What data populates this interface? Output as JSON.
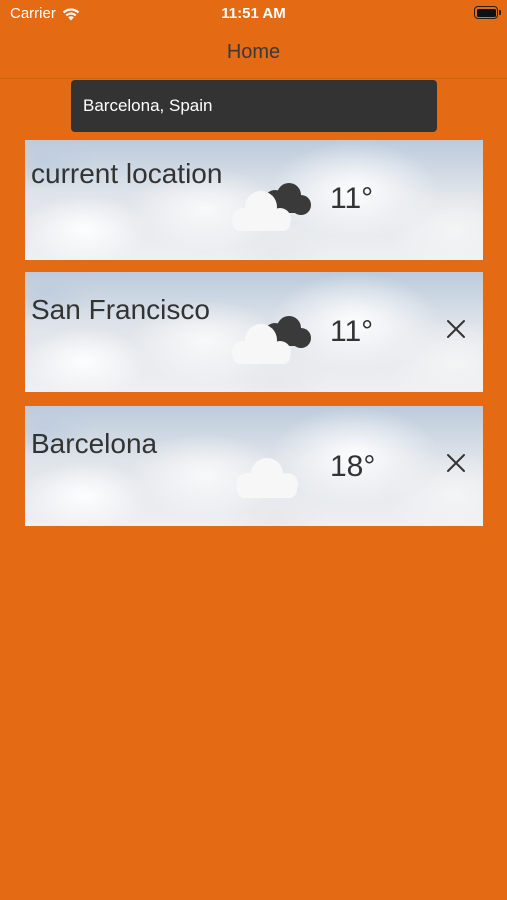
{
  "status_bar": {
    "carrier": "Carrier",
    "time": "11:51 AM"
  },
  "nav": {
    "title": "Home"
  },
  "search": {
    "value": "Barcelona, Spain"
  },
  "cards": [
    {
      "city": "current location",
      "temp": "11°",
      "icon": "cloud-dark-icon",
      "removable": false
    },
    {
      "city": "San Francisco",
      "temp": "11°",
      "icon": "cloud-dark-icon",
      "removable": true
    },
    {
      "city": "Barcelona",
      "temp": "18°",
      "icon": "cloud-icon",
      "removable": true
    }
  ],
  "colors": {
    "background": "#e46a14",
    "search_box": "#333333",
    "text": "#333333"
  }
}
